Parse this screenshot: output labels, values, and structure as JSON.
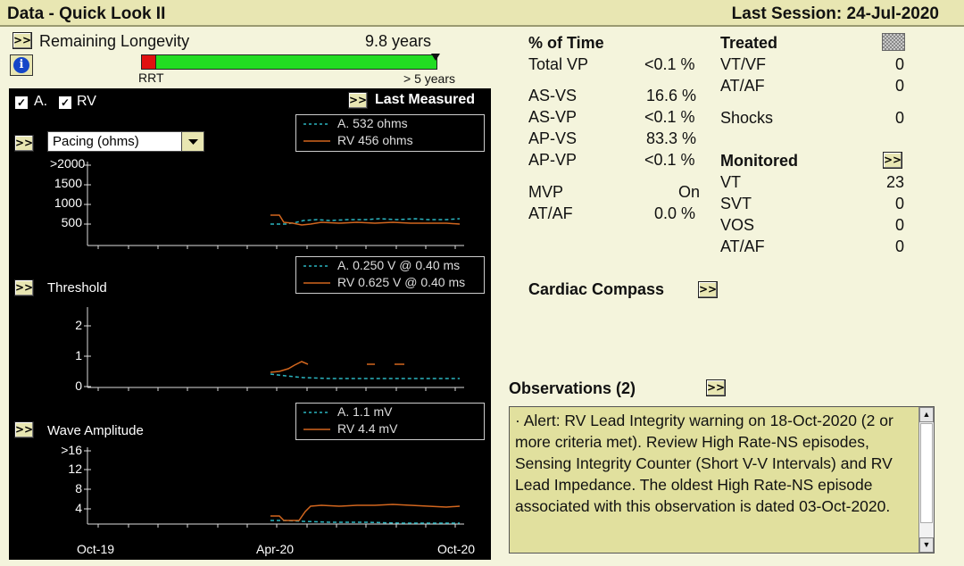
{
  "header": {
    "title": "Data - Quick Look II",
    "session": "Last Session: 24-Jul-2020"
  },
  "longevity": {
    "button": ">>",
    "label": "Remaining Longevity",
    "value": "9.8 years",
    "rrt": "RRT",
    "max": "> 5 years",
    "info_icon": "info-icon",
    "battery_fraction": 0.93
  },
  "graph_header": {
    "a_label": "A.",
    "rv_label": "RV",
    "a_checked": true,
    "rv_checked": true,
    "last_measured": "Last Measured",
    "button": ">>"
  },
  "pacing": {
    "button": ">>",
    "select_value": "Pacing (ohms)",
    "legend_a": "A.    532 ohms",
    "legend_rv": "RV  456 ohms",
    "ticks": [
      ">2000",
      "1500",
      "1000",
      "500"
    ]
  },
  "threshold": {
    "button": ">>",
    "label": "Threshold",
    "legend_a": "A.    0.250 V @ 0.40 ms",
    "legend_rv": "RV  0.625 V @ 0.40 ms",
    "ticks": [
      "2",
      "1",
      "0"
    ]
  },
  "wave": {
    "button": ">>",
    "label": "Wave Amplitude",
    "legend_a": "A.    1.1 mV",
    "legend_rv": "RV  4.4 mV",
    "ticks": [
      ">16",
      "12",
      "8",
      "4"
    ]
  },
  "xaxis": {
    "labels": [
      "Oct-19",
      "Apr-20",
      "Oct-20"
    ]
  },
  "percent_time": {
    "title": "% of Time",
    "rows": [
      {
        "label": "Total VP",
        "value": "<0.1 %"
      },
      {
        "label": "AS-VS",
        "value": "16.6 %"
      },
      {
        "label": "AS-VP",
        "value": "<0.1 %"
      },
      {
        "label": "AP-VS",
        "value": "83.3 %"
      },
      {
        "label": "AP-VP",
        "value": "<0.1 %"
      },
      {
        "label": "MVP",
        "value": "On"
      },
      {
        "label": "AT/AF",
        "value": "0.0 %"
      }
    ]
  },
  "treated": {
    "title": "Treated",
    "rows": [
      {
        "label": "VT/VF",
        "value": "0"
      },
      {
        "label": "AT/AF",
        "value": "0"
      },
      {
        "label": "Shocks",
        "value": "0"
      }
    ]
  },
  "monitored": {
    "title": "Monitored",
    "button": ">>",
    "rows": [
      {
        "label": "VT",
        "value": "23"
      },
      {
        "label": "SVT",
        "value": "0"
      },
      {
        "label": "VOS",
        "value": "0"
      },
      {
        "label": "AT/AF",
        "value": "0"
      }
    ]
  },
  "compass": {
    "label": "Cardiac Compass",
    "button": ">>"
  },
  "observations": {
    "title": "Observations (2)",
    "button": ">>",
    "text": "· Alert: RV Lead Integrity warning on 18-Oct-2020 (2 or more criteria met). Review High Rate-NS episodes, Sensing Integrity Counter (Short V-V Intervals) and RV Lead Impedance. The oldest High Rate-NS episode associated with this observation is dated 03-Oct-2020."
  },
  "colors": {
    "atrial": "#2bb5c0",
    "rv": "#d2661e",
    "battery_ok": "#22dd22",
    "battery_rrt": "#e01010"
  }
}
